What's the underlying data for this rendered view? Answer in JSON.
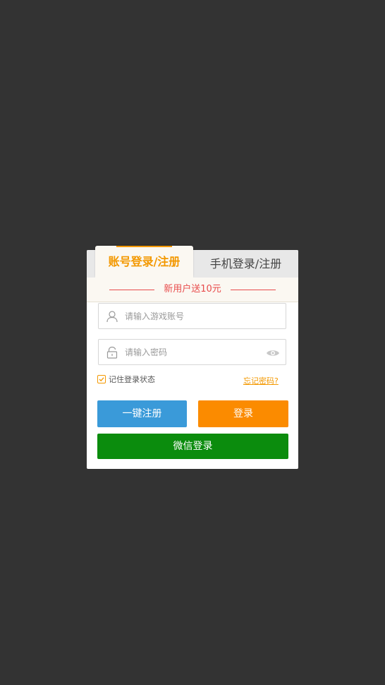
{
  "tabs": {
    "account": "账号登录/注册",
    "phone": "手机登录/注册"
  },
  "promo": {
    "text": "新用户送10元"
  },
  "account_field": {
    "placeholder": "请输入游戏账号",
    "icon": "user-icon"
  },
  "password_field": {
    "placeholder": "请输入密码",
    "icon": "lock-icon",
    "toggle_icon": "eye-icon"
  },
  "remember": {
    "label": "记住登录状态",
    "checked": true
  },
  "forgot": {
    "label": "忘记密码?"
  },
  "buttons": {
    "register": "一键注册",
    "login": "登录",
    "wechat": "微信登录"
  },
  "colors": {
    "accent": "#f39800",
    "promo": "#e84b4b",
    "register": "#3a9ad9",
    "login": "#fb8b00",
    "wechat": "#0b8c0d",
    "backdrop": "#333333"
  }
}
